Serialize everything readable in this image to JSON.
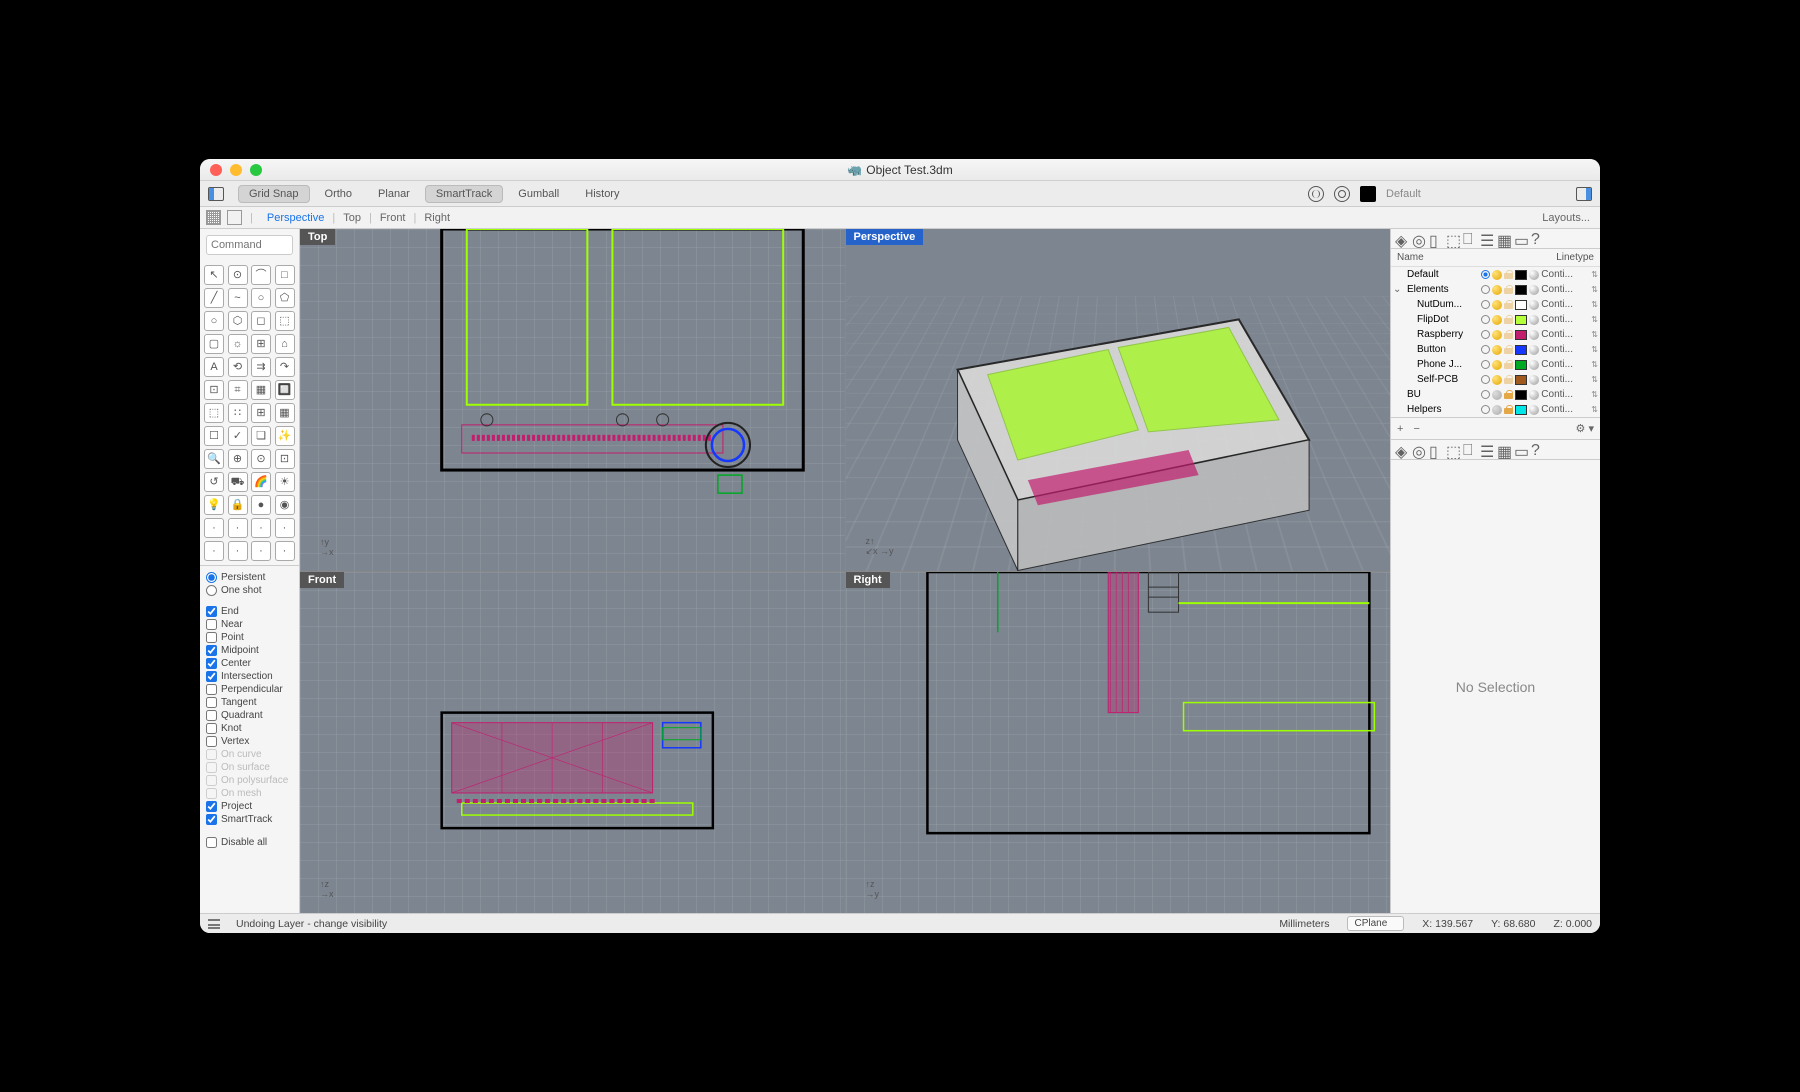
{
  "window": {
    "title": "Object Test.3dm"
  },
  "toolbar": {
    "buttons": [
      {
        "label": "Grid Snap",
        "on": true
      },
      {
        "label": "Ortho",
        "on": false
      },
      {
        "label": "Planar",
        "on": false
      },
      {
        "label": "SmartTrack",
        "on": true
      },
      {
        "label": "Gumball",
        "on": false
      },
      {
        "label": "History",
        "on": false
      }
    ],
    "layer_dropdown": "Default"
  },
  "view_tabs": [
    "Perspective",
    "Top",
    "Front",
    "Right"
  ],
  "view_tab_active": "Perspective",
  "layouts_label": "Layouts...",
  "command_placeholder": "Command",
  "viewports": {
    "tl": "Top",
    "tr": "Perspective",
    "bl": "Front",
    "br": "Right"
  },
  "osnap": {
    "mode_persistent": "Persistent",
    "mode_oneshot": "One shot",
    "mode_selected": "persistent",
    "options": [
      {
        "label": "End",
        "on": true
      },
      {
        "label": "Near",
        "on": false
      },
      {
        "label": "Point",
        "on": false
      },
      {
        "label": "Midpoint",
        "on": true
      },
      {
        "label": "Center",
        "on": true
      },
      {
        "label": "Intersection",
        "on": true
      },
      {
        "label": "Perpendicular",
        "on": false
      },
      {
        "label": "Tangent",
        "on": false
      },
      {
        "label": "Quadrant",
        "on": false
      },
      {
        "label": "Knot",
        "on": false
      },
      {
        "label": "Vertex",
        "on": false
      },
      {
        "label": "On curve",
        "on": false,
        "disabled": true
      },
      {
        "label": "On surface",
        "on": false,
        "disabled": true
      },
      {
        "label": "On polysurface",
        "on": false,
        "disabled": true
      },
      {
        "label": "On mesh",
        "on": false,
        "disabled": true
      },
      {
        "label": "Project",
        "on": true
      },
      {
        "label": "SmartTrack",
        "on": true
      }
    ],
    "disable_all": "Disable all"
  },
  "layers_panel": {
    "header_name": "Name",
    "header_linetype": "Linetype",
    "linetype_label": "Conti...",
    "rows": [
      {
        "name": "Default",
        "current": true,
        "on": true,
        "locked": false,
        "color": "#000000",
        "indent": 0
      },
      {
        "name": "Elements",
        "current": false,
        "on": true,
        "locked": false,
        "color": "#000000",
        "indent": 0,
        "expandable": true
      },
      {
        "name": "NutDum...",
        "current": false,
        "on": true,
        "locked": false,
        "color": "#ffffff",
        "indent": 1
      },
      {
        "name": "FlipDot",
        "current": false,
        "on": true,
        "locked": false,
        "color": "#b6ff3b",
        "indent": 1
      },
      {
        "name": "Raspberry",
        "current": false,
        "on": true,
        "locked": false,
        "color": "#c21e6e",
        "indent": 1
      },
      {
        "name": "Button",
        "current": false,
        "on": true,
        "locked": false,
        "color": "#1438ff",
        "indent": 1
      },
      {
        "name": "Phone J...",
        "current": false,
        "on": true,
        "locked": false,
        "color": "#00a823",
        "indent": 1
      },
      {
        "name": "Self-PCB",
        "current": false,
        "on": true,
        "locked": false,
        "color": "#a05a1e",
        "indent": 1
      },
      {
        "name": "BU",
        "current": false,
        "on": false,
        "locked": true,
        "color": "#000000",
        "indent": 0
      },
      {
        "name": "Helpers",
        "current": false,
        "on": false,
        "locked": true,
        "color": "#00e5e5",
        "indent": 0
      }
    ]
  },
  "properties": {
    "no_selection": "No Selection"
  },
  "status": {
    "message": "Undoing Layer - change visibility",
    "units": "Millimeters",
    "plane_selector": "CPlane",
    "x": "X: 139.567",
    "y": "Y: 68.680",
    "z": "Z: 0.000"
  }
}
